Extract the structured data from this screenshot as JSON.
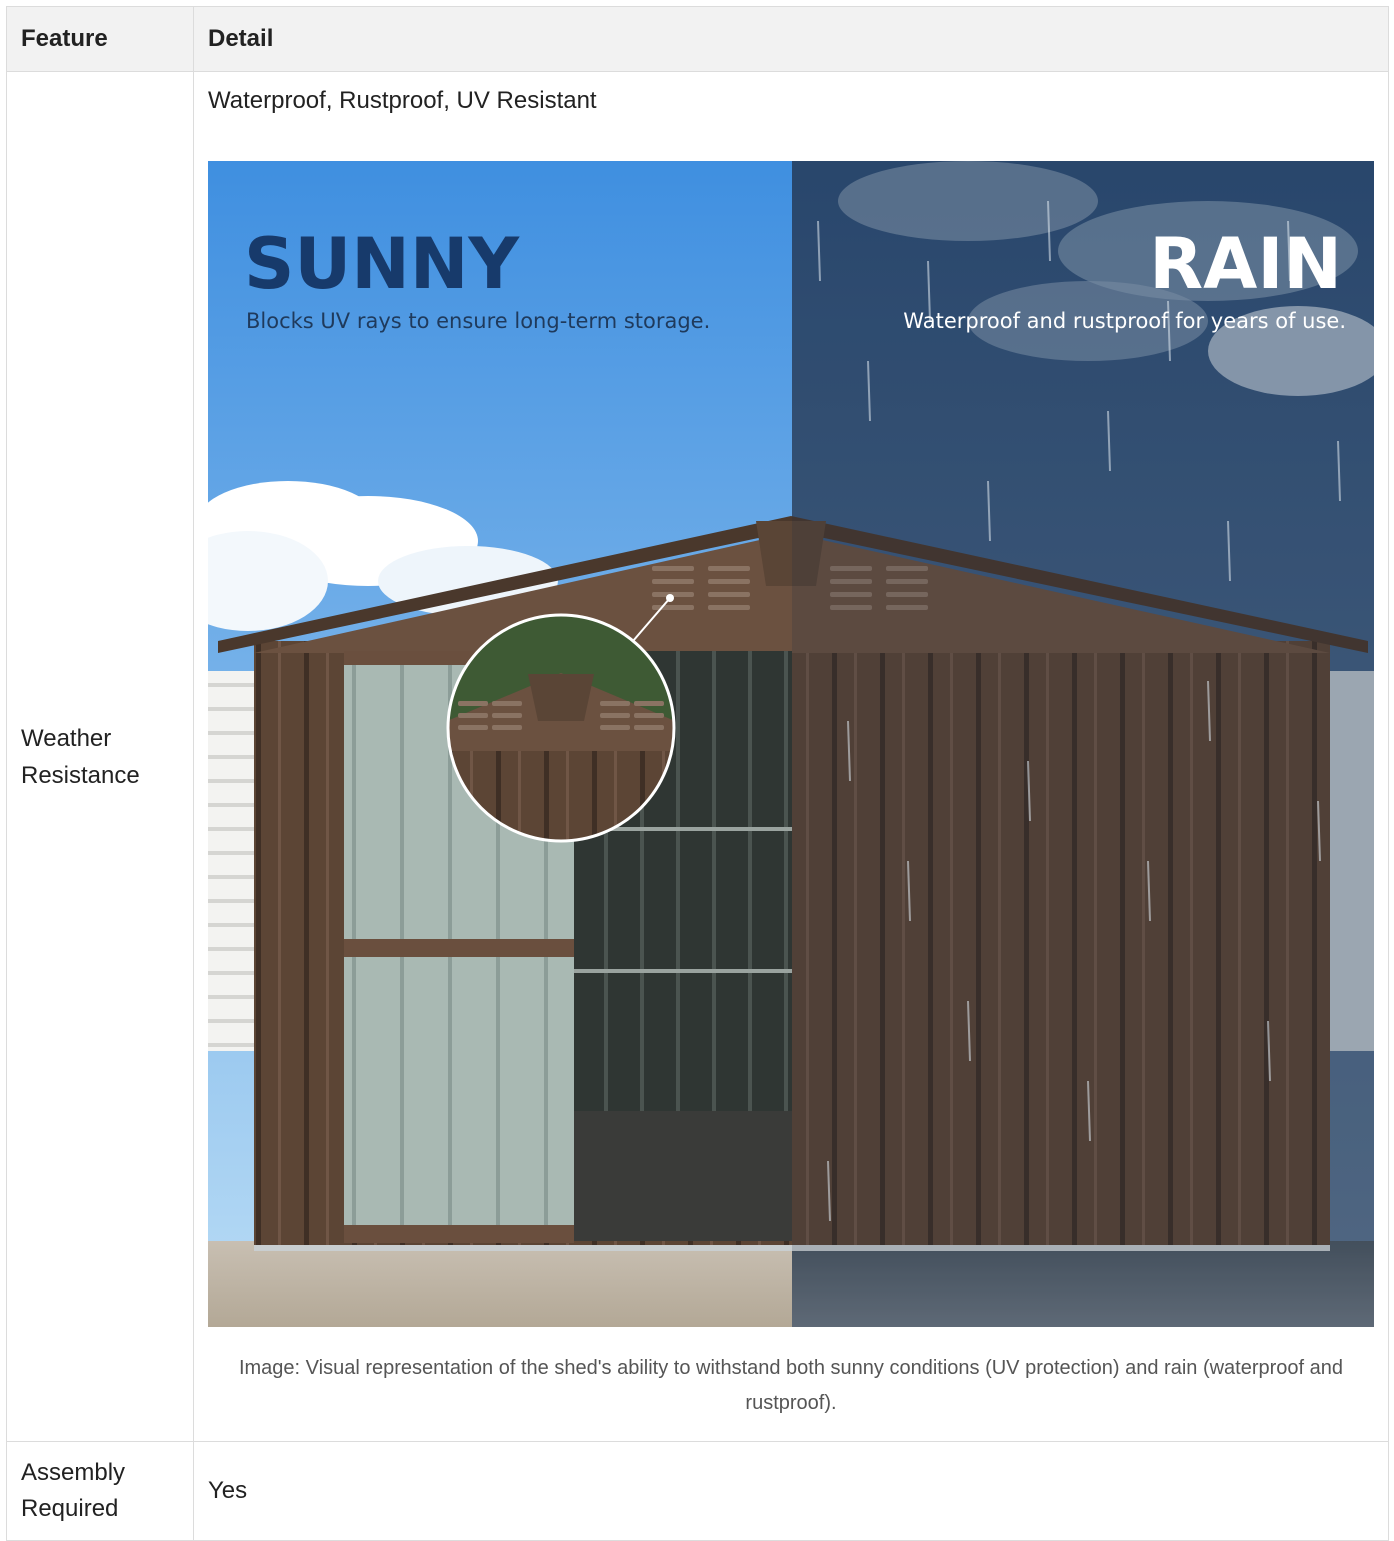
{
  "table": {
    "headers": [
      "Feature",
      "Detail"
    ],
    "rows": [
      {
        "feature": "Weather Resistance",
        "feature_lines": [
          "Weather",
          "Resistance"
        ],
        "detail": "Waterproof, Rustproof, UV Resistant",
        "image": {
          "left_title": "SUNNY",
          "left_subtitle": "Blocks UV rays to ensure long-term storage.",
          "right_title": "RAIN",
          "right_subtitle": "Waterproof and rustproof for years of use.",
          "caption": "Image: Visual representation of the shed's ability to withstand both sunny conditions (UV protection) and rain (waterproof and rustproof)."
        }
      },
      {
        "feature": "Assembly Required",
        "feature_lines": [
          "Assembly",
          "Required"
        ],
        "detail": "Yes"
      }
    ]
  },
  "colors": {
    "header_bg": "#f2f2f2",
    "border": "#dcdcdc",
    "sunny_title": "#173a6b",
    "shed_brown": "#5a4434"
  }
}
